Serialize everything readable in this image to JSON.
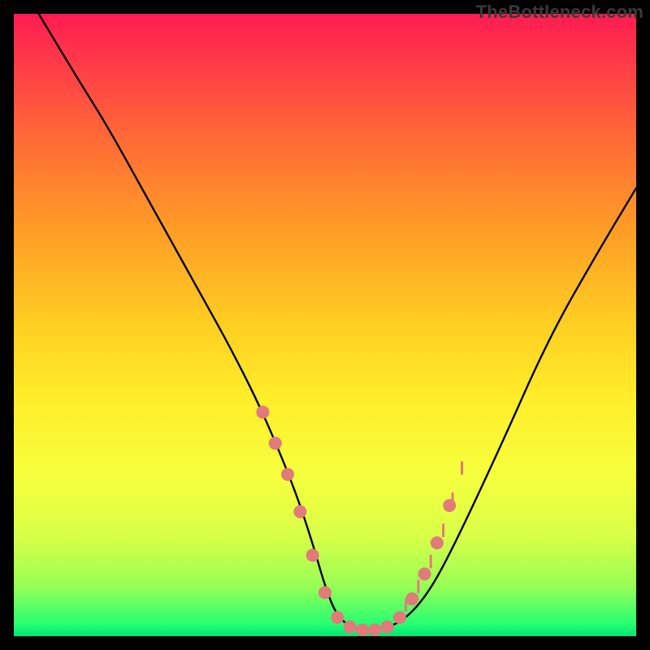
{
  "watermark": {
    "text": "TheBottleneck.com"
  },
  "chart_data": {
    "type": "line",
    "title": "",
    "xlabel": "",
    "ylabel": "",
    "xlim": [
      0,
      100
    ],
    "ylim": [
      0,
      100
    ],
    "grid": false,
    "legend": false,
    "series": [
      {
        "name": "main-curve",
        "color": "#000000",
        "x": [
          4,
          10,
          15,
          20,
          25,
          30,
          35,
          40,
          45,
          48,
          50,
          52,
          55,
          58,
          62,
          66,
          70,
          78,
          86,
          94,
          100
        ],
        "y": [
          100,
          90,
          82,
          73,
          64,
          55,
          46,
          36,
          24,
          15,
          8,
          3,
          1,
          1,
          2,
          6,
          13,
          30,
          48,
          62,
          72
        ]
      }
    ],
    "markers": {
      "name": "highlight-dots",
      "color": "#e17a7a",
      "radius": 8,
      "points": [
        {
          "x": 40,
          "y": 36
        },
        {
          "x": 42,
          "y": 31
        },
        {
          "x": 44,
          "y": 26
        },
        {
          "x": 46,
          "y": 20
        },
        {
          "x": 48,
          "y": 13
        },
        {
          "x": 50,
          "y": 7
        },
        {
          "x": 52,
          "y": 3
        },
        {
          "x": 54,
          "y": 1.5
        },
        {
          "x": 56,
          "y": 1
        },
        {
          "x": 58,
          "y": 1
        },
        {
          "x": 60,
          "y": 1.5
        },
        {
          "x": 62,
          "y": 3
        },
        {
          "x": 64,
          "y": 6
        },
        {
          "x": 66,
          "y": 10
        },
        {
          "x": 68,
          "y": 15
        },
        {
          "x": 70,
          "y": 21
        }
      ]
    },
    "tick_markers": {
      "name": "x-ticks-top-of-valley",
      "color": "#e17a7a",
      "height": 14,
      "points": [
        {
          "x": 63,
          "y": 5
        },
        {
          "x": 65,
          "y": 8
        },
        {
          "x": 67,
          "y": 12
        },
        {
          "x": 69,
          "y": 17
        },
        {
          "x": 70.5,
          "y": 22
        },
        {
          "x": 72,
          "y": 27
        }
      ]
    }
  }
}
